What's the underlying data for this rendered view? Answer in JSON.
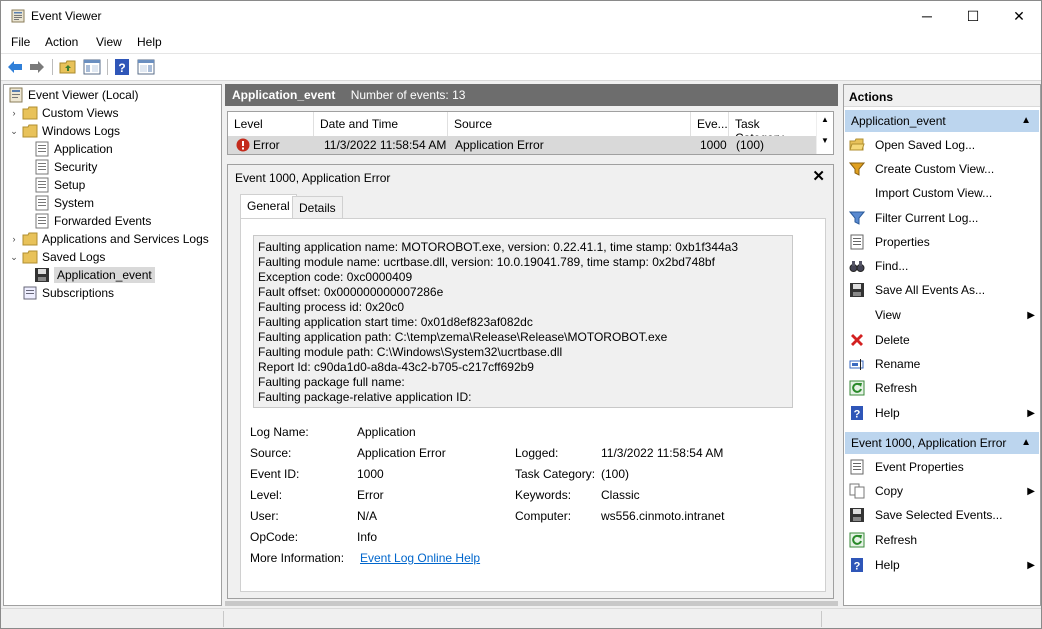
{
  "window": {
    "title": "Event Viewer",
    "minimize": "─",
    "maximize": "☐",
    "close": "✕"
  },
  "menu": {
    "file": "File",
    "action": "Action",
    "view": "View",
    "help": "Help"
  },
  "toolbar": {
    "icons": [
      "back-arrow-icon",
      "forward-arrow-icon",
      "folder-up-icon",
      "show-hide-tree-icon",
      "help-icon",
      "show-hide-action-pane-icon"
    ]
  },
  "tree": {
    "root": "Event Viewer (Local)",
    "custom_views": "Custom Views",
    "windows_logs": "Windows Logs",
    "application": "Application",
    "security": "Security",
    "setup": "Setup",
    "system": "System",
    "forwarded": "Forwarded Events",
    "apps_services": "Applications and Services Logs",
    "saved_logs": "Saved Logs",
    "application_event": "Application_event",
    "subscriptions": "Subscriptions"
  },
  "center": {
    "log_name": "Application_event",
    "event_count": "Number of events: 13",
    "columns": {
      "level": "Level",
      "date": "Date and Time",
      "source": "Source",
      "event_id": "Eve...",
      "task": "Task Category"
    },
    "row": {
      "level": "Error",
      "date": "11/3/2022 11:58:54 AM",
      "source": "Application Error",
      "event_id": "1000",
      "task": "(100)"
    },
    "detail_title": "Event 1000, Application Error",
    "tab_general": "General",
    "tab_details": "Details",
    "description": [
      "Faulting application name: MOTOROBOT.exe, version: 0.22.41.1, time stamp: 0xb1f344a3",
      "Faulting module name: ucrtbase.dll, version: 10.0.19041.789, time stamp: 0x2bd748bf",
      "Exception code: 0xc0000409",
      "Fault offset: 0x000000000007286e",
      "Faulting process id: 0x20c0",
      "Faulting application start time: 0x01d8ef823af082dc",
      "Faulting application path: C:\\temp\\zema\\Release\\Release\\MOTOROBOT.exe",
      "Faulting module path: C:\\Windows\\System32\\ucrtbase.dll",
      "Report Id: c90da1d0-a8da-43c2-b705-c217cff692b9",
      "Faulting package full name:",
      "Faulting package-relative application ID:"
    ],
    "props": {
      "log_name_label": "Log Name:",
      "log_name_value": "Application",
      "source_label": "Source:",
      "source_value": "Application Error",
      "logged_label": "Logged:",
      "logged_value": "11/3/2022 11:58:54 AM",
      "event_id_label": "Event ID:",
      "event_id_value": "1000",
      "task_label": "Task Category:",
      "task_value": "(100)",
      "level_label": "Level:",
      "level_value": "Error",
      "keywords_label": "Keywords:",
      "keywords_value": "Classic",
      "user_label": "User:",
      "user_value": "N/A",
      "computer_label": "Computer:",
      "computer_value": "ws556.cinmoto.intranet",
      "opcode_label": "OpCode:",
      "opcode_value": "Info",
      "more_info_label": "More Information:",
      "more_info_link": "Event Log Online Help"
    }
  },
  "actions": {
    "header": "Actions",
    "section1": "Application_event",
    "open_saved": "Open Saved Log...",
    "create_custom": "Create Custom View...",
    "import_custom": "Import Custom View...",
    "filter": "Filter Current Log...",
    "properties": "Properties",
    "find": "Find...",
    "save_all": "Save All Events As...",
    "view": "View",
    "delete": "Delete",
    "rename": "Rename",
    "refresh1": "Refresh",
    "help1": "Help",
    "section2": "Event 1000, Application Error",
    "event_props": "Event Properties",
    "copy": "Copy",
    "save_selected": "Save Selected Events...",
    "refresh2": "Refresh",
    "help2": "Help"
  }
}
